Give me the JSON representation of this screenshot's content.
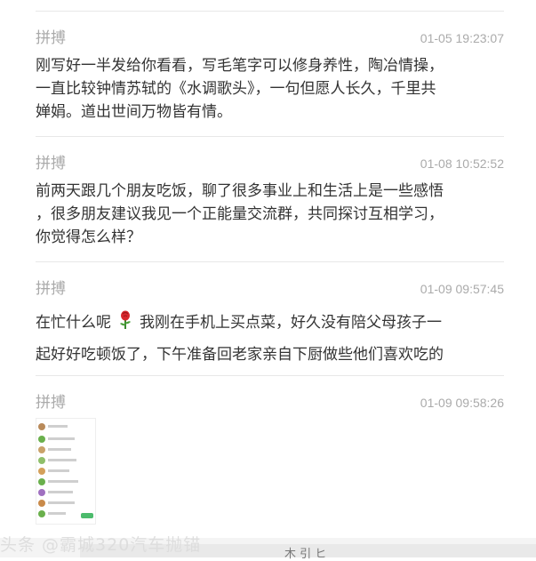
{
  "messages": [
    {
      "sender": "拼搏",
      "time": "01-05 19:23:07",
      "lines": [
        "刚写好一半发给你看看，写毛笔字可以修身养性，陶冶情操，",
        "一直比较钟情苏轼的《水调歌头》，一句但愿人长久，千里共",
        "婵娟。道出世间万物皆有情。"
      ]
    },
    {
      "sender": "拼搏",
      "time": "01-08 10:52:52",
      "lines": [
        "前两天跟几个朋友吃饭，聊了很多事业上和生活上是一些感悟",
        "，很多朋友建议我见一个正能量交流群，共同探讨互相学习，",
        "你觉得怎么样？"
      ]
    },
    {
      "sender": "拼搏",
      "time": "01-09 09:57:45",
      "line1_before": "在忙什么呢",
      "emoji": "rose-emoji",
      "line1_after": "我刚在手机上买点菜，好久没有陪父母孩子一",
      "line2": "起好好吃顿饭了，下午准备回老家亲自下厨做些他们喜欢吃的"
    },
    {
      "sender": "拼搏",
      "time": "01-09 09:58:26",
      "image": "screenshot-thumbnail"
    }
  ],
  "watermark": "头条 @霸城320汽车抛锚",
  "footer_stamp": "木 引 ヒ",
  "colors": {
    "muted": "#aaaaaa",
    "text": "#333333",
    "divider": "#e8e8e8",
    "accent_green": "#4cbb6c"
  }
}
